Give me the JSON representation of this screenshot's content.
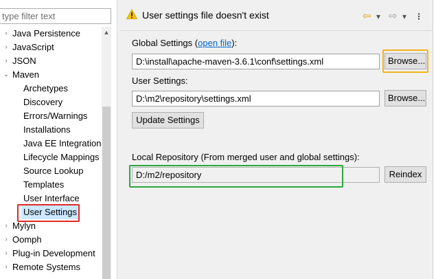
{
  "filter": {
    "placeholder": "type filter text"
  },
  "tree": [
    {
      "label": "Java Persistence",
      "arrow": "›",
      "level": 0
    },
    {
      "label": "JavaScript",
      "arrow": "›",
      "level": 0
    },
    {
      "label": "JSON",
      "arrow": "›",
      "level": 0
    },
    {
      "label": "Maven",
      "arrow": "⌄",
      "level": 0,
      "expanded": true
    },
    {
      "label": "Archetypes",
      "level": 1
    },
    {
      "label": "Discovery",
      "level": 1
    },
    {
      "label": "Errors/Warnings",
      "level": 1
    },
    {
      "label": "Installations",
      "level": 1
    },
    {
      "label": "Java EE Integration",
      "level": 1
    },
    {
      "label": "Lifecycle Mappings",
      "level": 1
    },
    {
      "label": "Source Lookup",
      "level": 1
    },
    {
      "label": "Templates",
      "level": 1
    },
    {
      "label": "User Interface",
      "level": 1
    },
    {
      "label": "User Settings",
      "level": 1,
      "selected": true
    },
    {
      "label": "Mylyn",
      "arrow": "›",
      "level": 0
    },
    {
      "label": "Oomph",
      "arrow": "›",
      "level": 0
    },
    {
      "label": "Plug-in Development",
      "arrow": "›",
      "level": 0
    },
    {
      "label": "Remote Systems",
      "arrow": "›",
      "level": 0
    }
  ],
  "scroll_up_glyph": "▲",
  "header": {
    "message": "User settings file doesn't exist",
    "nav": {
      "back": "⇦",
      "back_menu": "▾",
      "forward": "⇨",
      "forward_menu": "▾",
      "view_menu": "⋮"
    },
    "warning_color": "#f5c400"
  },
  "global_settings": {
    "label": "Global Settings",
    "link_prefix": " (",
    "link": "open file",
    "link_suffix": "):",
    "value": "D:\\install\\apache-maven-3.6.1\\conf\\settings.xml",
    "browse": "Browse..."
  },
  "user_settings": {
    "label": "User Settings:",
    "value": "D:\\m2\\repository\\settings.xml",
    "browse": "Browse...",
    "update": "Update Settings"
  },
  "local_repository": {
    "label": "Local Repository (From merged user and global settings):",
    "value": "D:/m2/repository",
    "reindex": "Reindex"
  },
  "highlights": {
    "selected_item": "#e32727",
    "browse": "#f4b21b",
    "repo": "#27a83c"
  }
}
